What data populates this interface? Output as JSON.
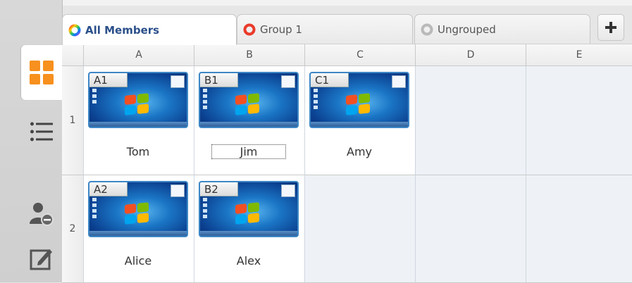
{
  "tabs": [
    {
      "label": "All Members",
      "icon": "rainbow-ring-icon",
      "active": true
    },
    {
      "label": "Group 1",
      "icon": "red-ring-icon",
      "active": false
    },
    {
      "label": "Ungrouped",
      "icon": "gray-ring-icon",
      "active": false
    }
  ],
  "add_tab_icon": "plus-icon",
  "sidebar": [
    {
      "name": "thumbnail-view-icon",
      "active": true
    },
    {
      "name": "list-view-icon",
      "active": false
    },
    {
      "name": "user-remove-icon",
      "active": false
    },
    {
      "name": "edit-icon",
      "active": false
    }
  ],
  "columns": [
    "A",
    "B",
    "C",
    "D",
    "E"
  ],
  "rows": [
    "1",
    "2"
  ],
  "members": [
    {
      "cell": "A1",
      "name": "Tom"
    },
    {
      "cell": "B1",
      "name": "Jim",
      "focused": true
    },
    {
      "cell": "C1",
      "name": "Amy"
    },
    {
      "cell": "A2",
      "name": "Alice"
    },
    {
      "cell": "B2",
      "name": "Alex"
    }
  ],
  "colors": {
    "accent_orange": "#f7901e",
    "tab_active_text": "#2a4f8a",
    "thumb_border": "#3d87c6"
  }
}
